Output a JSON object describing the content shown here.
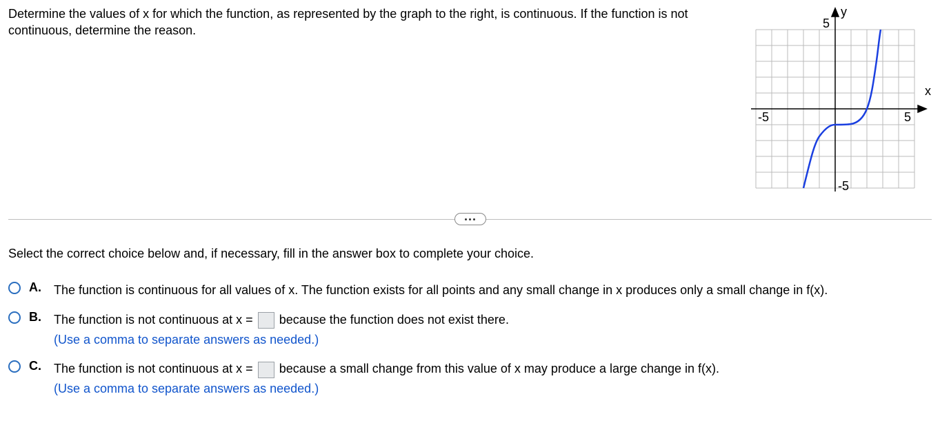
{
  "question": "Determine the values of x for which the function, as represented by the graph to the right, is continuous. If the function is not continuous, determine the reason.",
  "instruction": "Select the correct choice below and, if necessary, fill in the answer box to complete your choice.",
  "choices": {
    "A": {
      "label": "A.",
      "text": "The function is continuous for all values of x. The function exists for all points and any small change in x produces only a small change in f(x)."
    },
    "B": {
      "label": "B.",
      "prefix": "The function is not continuous at x =",
      "suffix": "because the function does not exist there.",
      "hint": "(Use a comma to separate answers as needed.)"
    },
    "C": {
      "label": "C.",
      "prefix": "The function is not continuous at x =",
      "suffix": "because a small change from this value of x may produce a large change in f(x).",
      "hint": "(Use a comma to separate answers as needed.)"
    }
  },
  "chart_data": {
    "type": "line",
    "title": "",
    "xlabel": "x",
    "ylabel": "y",
    "xlim": [
      -5,
      5
    ],
    "ylim": [
      -5,
      5
    ],
    "tick_labels": {
      "x": [
        -5,
        5
      ],
      "y": [
        -5,
        5
      ]
    },
    "grid": true,
    "curve_description": "Smooth continuous curve passing through origin, resembling a cubic with an inflection near x=1, rising steeply for x>2 and descending for x<-1.",
    "series": [
      {
        "name": "f(x)",
        "x": [
          -2,
          -1.5,
          -1,
          -0.5,
          0,
          0.5,
          1,
          1.5,
          2,
          2.2,
          2.5,
          2.7
        ],
        "values": [
          -5,
          -3,
          -1.8,
          -1.2,
          -1,
          -1,
          -1,
          -0.8,
          0,
          1,
          3,
          5
        ]
      }
    ]
  }
}
